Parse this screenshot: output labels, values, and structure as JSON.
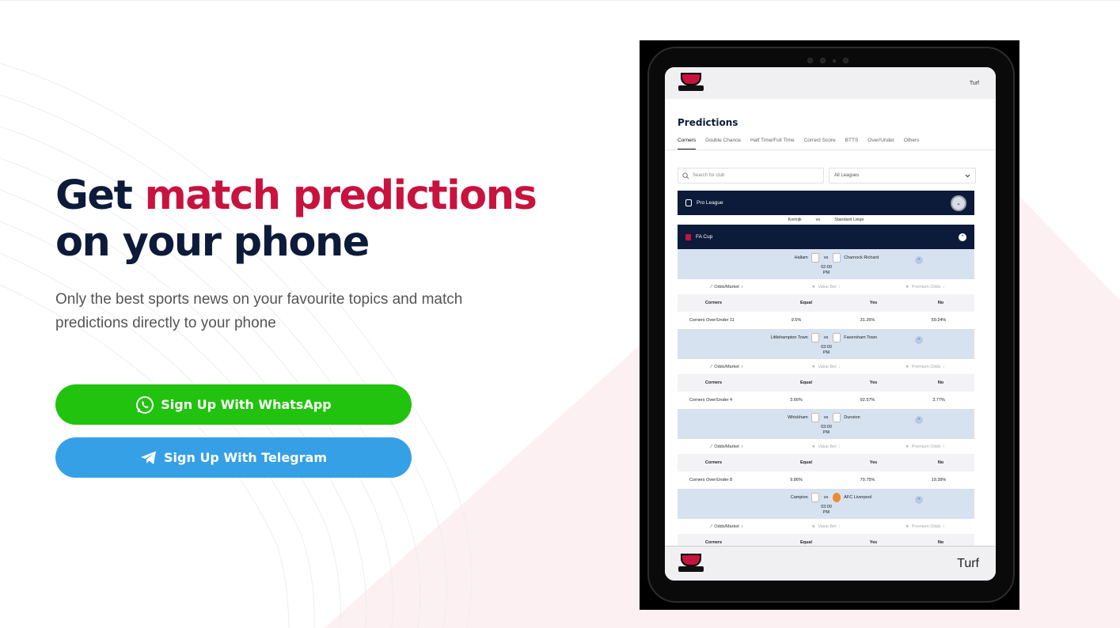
{
  "hero": {
    "title_plain": "Get",
    "title_accent": "match predictions",
    "title_line2": "on your phone",
    "subtitle": "Only the best sports news on your favourite topics and match predictions directly to your phone",
    "whatsapp_button": "Sign Up With WhatsApp",
    "telegram_button": "Sign Up With Telegram"
  },
  "colors": {
    "accent": "#c8133f",
    "navy": "#0d1b3a",
    "whatsapp": "#21c30f",
    "telegram": "#36a0e6"
  },
  "app": {
    "header_link": "Turf",
    "page_title": "Predictions",
    "tabs": [
      "Corners",
      "Double Chance",
      "Half Time/Full Time",
      "Correct Score",
      "BTTS",
      "Over/Under",
      "Others"
    ],
    "search_placeholder": "Search for club",
    "league_select": "All Leagues",
    "leagues": [
      {
        "name": "Pro League",
        "peek_home": "Kortrijk",
        "peek_vs": "vs",
        "peek_away": "Standard Liège"
      },
      {
        "name": "FA Cup"
      }
    ],
    "column_headers": {
      "market": "Corners",
      "equal": "Equal",
      "yes": "Yes",
      "no": "No"
    },
    "odds_labels": {
      "odds": "Odds/Market",
      "value": "Value Bet",
      "premium": "Premium Odds"
    },
    "matches": [
      {
        "home": "Hallam",
        "vs": "vs",
        "away": "Charnock Richard",
        "time": "02:00",
        "ampm": "PM",
        "market": "Corners Over/Under 11",
        "equal": "9.5%",
        "yes": "31.26%",
        "no": "59.24%"
      },
      {
        "home": "Littlehampton Town",
        "vs": "vs",
        "away": "Faversham Town",
        "time": "03:00",
        "ampm": "PM",
        "market": "Corners Over/Under 4",
        "equal": "3.66%",
        "yes": "92.57%",
        "no": "3.77%"
      },
      {
        "home": "Whickham",
        "vs": "vs",
        "away": "Dunston",
        "time": "03:00",
        "ampm": "PM",
        "market": "Corners Over/Under 8",
        "equal": "9.86%",
        "yes": "70.75%",
        "no": "19.39%"
      },
      {
        "home": "Campion",
        "vs": "vs",
        "away": "AFC Liverpool",
        "time": "03:00",
        "ampm": "PM"
      }
    ],
    "footer_link": "Turf"
  }
}
